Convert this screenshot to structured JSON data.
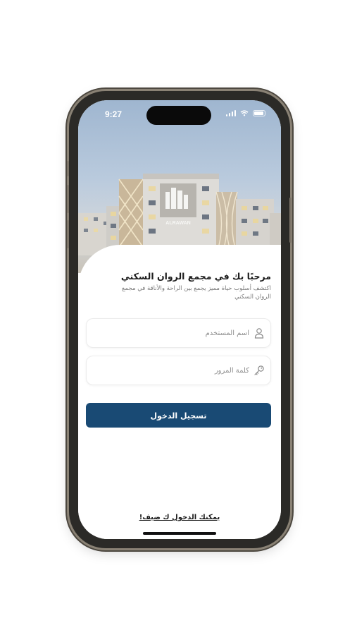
{
  "status_bar": {
    "time": "9:27"
  },
  "hero": {
    "logo_text": "ALRAWAN"
  },
  "welcome": {
    "title": "مرحبًا بك في مجمع الروان السكني",
    "subtitle": "اكتشف أسلوب حياة مميز يجمع بين الراحة والأناقة في مجمع الروان السكني"
  },
  "form": {
    "username_placeholder": "اسم المستخدم",
    "password_placeholder": "كلمة المرور",
    "login_label": "تسجيل الدخول"
  },
  "guest_link": "يمكنك الدخول ك ضيف!",
  "colors": {
    "primary": "#194a74"
  },
  "icons": {
    "username": "user-icon",
    "password": "key-icon"
  }
}
